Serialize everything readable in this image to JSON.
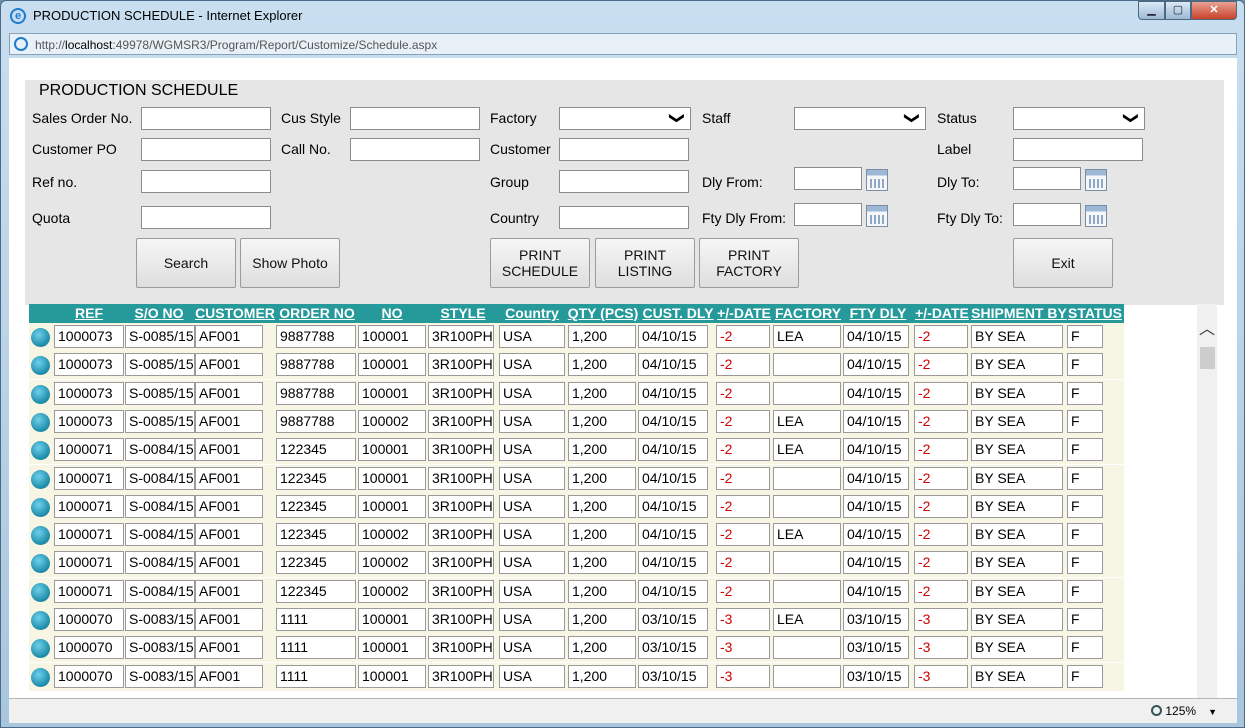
{
  "window": {
    "title": "PRODUCTION SCHEDULE - Internet Explorer",
    "min": "▁",
    "max": "▢",
    "close": "✕"
  },
  "address": {
    "prefix": "http://",
    "host": "localhost",
    "rest": ":49978/WGMSR3/Program/Report/Customize/Schedule.aspx"
  },
  "status": {
    "zoom": "125%",
    "zoom_arrow": "▼"
  },
  "panel": {
    "title": "PRODUCTION SCHEDULE",
    "labels": {
      "sales_order": "Sales Order No.",
      "cus_style": "Cus Style",
      "factory": "Factory",
      "staff": "Staff",
      "status": "Status",
      "customer_po": "Customer PO",
      "call_no": "Call No.",
      "customer": "Customer",
      "label": "Label",
      "ref_no": "Ref no.",
      "group": "Group",
      "dly_from": "Dly From:",
      "dly_to": "Dly To:",
      "quota": "Quota",
      "country": "Country",
      "fty_dly_from": "Fty Dly From:",
      "fty_dly_to": "Fty Dly To:"
    },
    "buttons": {
      "search": "Search",
      "show_photo": "Show Photo",
      "print_schedule_1": "PRINT",
      "print_schedule_2": "SCHEDULE",
      "print_listing_1": "PRINT",
      "print_listing_2": "LISTING",
      "print_factory_1": "PRINT",
      "print_factory_2": "FACTORY",
      "exit": "Exit"
    },
    "chevron": "❯"
  },
  "grid": {
    "headers": [
      "REF",
      "S/O NO",
      "CUSTOMER",
      "ORDER NO",
      "NO",
      "STYLE",
      "Country",
      "QTY (PCS)",
      "CUST. DLY",
      "+/-DATE",
      "FACTORY",
      "FTY DLY",
      "+/-DATE",
      "SHIPMENT BY",
      "STATUS"
    ],
    "rows": [
      [
        "1000073",
        "S-0085/15",
        "AF001",
        "9887788",
        "100001",
        "3R100PH",
        "USA",
        "1,200",
        "04/10/15",
        "-2",
        "LEA",
        "04/10/15",
        "-2",
        "BY SEA",
        "F"
      ],
      [
        "1000073",
        "S-0085/15",
        "AF001",
        "9887788",
        "100001",
        "3R100PH",
        "USA",
        "1,200",
        "04/10/15",
        "-2",
        "",
        "04/10/15",
        "-2",
        "BY SEA",
        "F"
      ],
      [
        "1000073",
        "S-0085/15",
        "AF001",
        "9887788",
        "100001",
        "3R100PH",
        "USA",
        "1,200",
        "04/10/15",
        "-2",
        "",
        "04/10/15",
        "-2",
        "BY SEA",
        "F"
      ],
      [
        "1000073",
        "S-0085/15",
        "AF001",
        "9887788",
        "100002",
        "3R100PH",
        "USA",
        "1,200",
        "04/10/15",
        "-2",
        "LEA",
        "04/10/15",
        "-2",
        "BY SEA",
        "F"
      ],
      [
        "1000071",
        "S-0084/15",
        "AF001",
        "122345",
        "100001",
        "3R100PH",
        "USA",
        "1,200",
        "04/10/15",
        "-2",
        "LEA",
        "04/10/15",
        "-2",
        "BY SEA",
        "F"
      ],
      [
        "1000071",
        "S-0084/15",
        "AF001",
        "122345",
        "100001",
        "3R100PH",
        "USA",
        "1,200",
        "04/10/15",
        "-2",
        "",
        "04/10/15",
        "-2",
        "BY SEA",
        "F"
      ],
      [
        "1000071",
        "S-0084/15",
        "AF001",
        "122345",
        "100001",
        "3R100PH",
        "USA",
        "1,200",
        "04/10/15",
        "-2",
        "",
        "04/10/15",
        "-2",
        "BY SEA",
        "F"
      ],
      [
        "1000071",
        "S-0084/15",
        "AF001",
        "122345",
        "100002",
        "3R100PH",
        "USA",
        "1,200",
        "04/10/15",
        "-2",
        "LEA",
        "04/10/15",
        "-2",
        "BY SEA",
        "F"
      ],
      [
        "1000071",
        "S-0084/15",
        "AF001",
        "122345",
        "100002",
        "3R100PH",
        "USA",
        "1,200",
        "04/10/15",
        "-2",
        "",
        "04/10/15",
        "-2",
        "BY SEA",
        "F"
      ],
      [
        "1000071",
        "S-0084/15",
        "AF001",
        "122345",
        "100002",
        "3R100PH",
        "USA",
        "1,200",
        "04/10/15",
        "-2",
        "",
        "04/10/15",
        "-2",
        "BY SEA",
        "F"
      ],
      [
        "1000070",
        "S-0083/15",
        "AF001",
        "1111",
        "100001",
        "3R100PH",
        "USA",
        "1,200",
        "03/10/15",
        "-3",
        "LEA",
        "03/10/15",
        "-3",
        "BY SEA",
        "F"
      ],
      [
        "1000070",
        "S-0083/15",
        "AF001",
        "1111",
        "100001",
        "3R100PH",
        "USA",
        "1,200",
        "03/10/15",
        "-3",
        "",
        "03/10/15",
        "-3",
        "BY SEA",
        "F"
      ],
      [
        "1000070",
        "S-0083/15",
        "AF001",
        "1111",
        "100001",
        "3R100PH",
        "USA",
        "1,200",
        "03/10/15",
        "-3",
        "",
        "03/10/15",
        "-3",
        "BY SEA",
        "F"
      ]
    ]
  },
  "scroll_up": "︿"
}
